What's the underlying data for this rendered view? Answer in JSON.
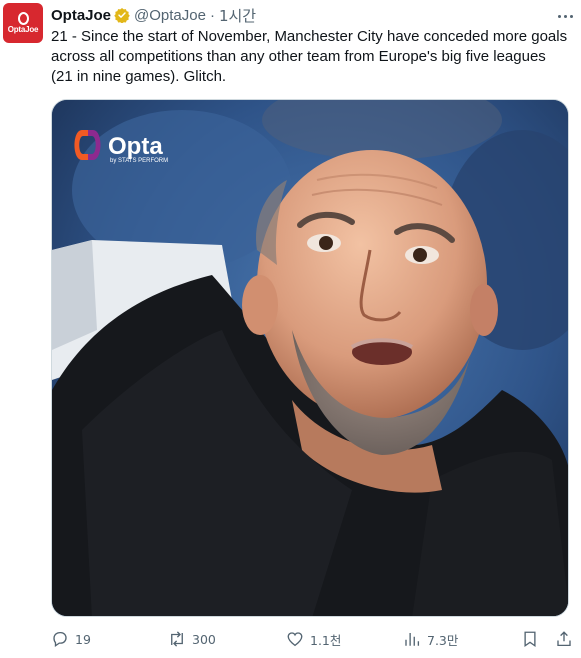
{
  "account": {
    "name": "OptaJoe",
    "handle": "@OptaJoe",
    "separator": "·",
    "time": "1시간",
    "avatar_label": "OptaJoe",
    "verified_color": "#e2b719"
  },
  "tweet": {
    "text": "21 - Since the start of November, Manchester City have conceded more goals across all competitions than any other team from Europe's big five leagues (21 in nine games). Glitch."
  },
  "media": {
    "logo_text": "Opta",
    "logo_subtext": "by STATS PERFORM"
  },
  "actions": {
    "replies": "19",
    "reposts": "300",
    "likes": "1.1천",
    "views": "7.3만"
  },
  "icons": [
    "verified-badge-icon",
    "more-icon",
    "reply-icon",
    "repost-icon",
    "like-icon",
    "views-icon",
    "bookmark-icon",
    "share-icon"
  ]
}
